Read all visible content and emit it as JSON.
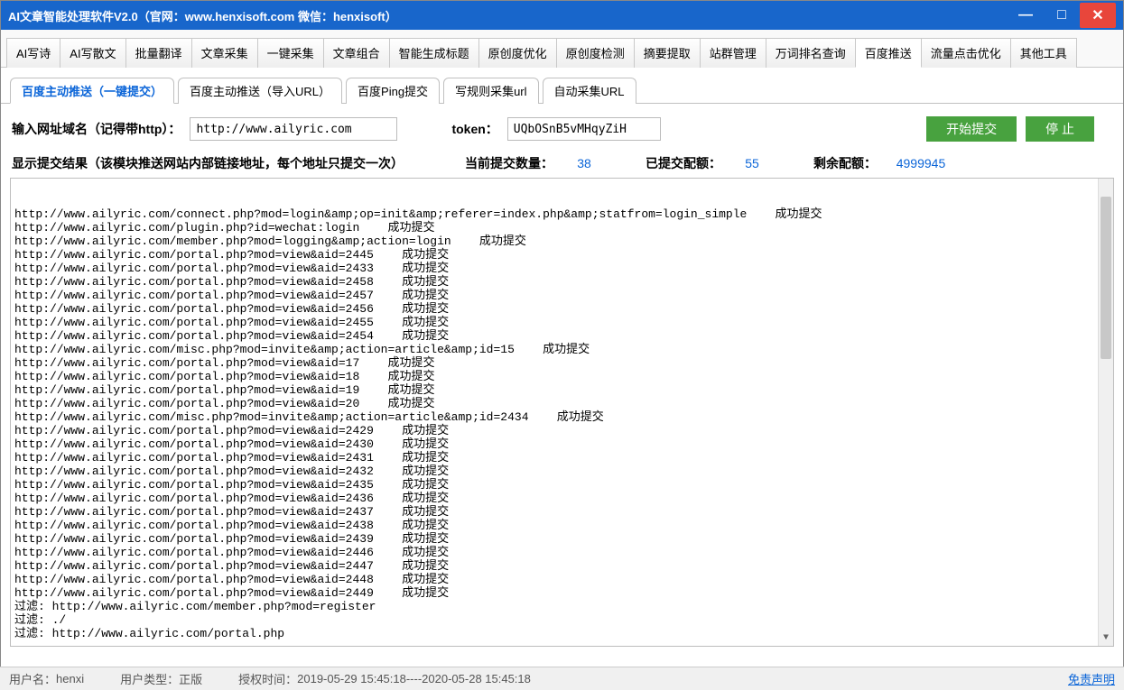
{
  "title": "AI文章智能处理软件V2.0（官网：www.henxisoft.com  微信：henxisoft）",
  "mainTabs": [
    "AI写诗",
    "AI写散文",
    "批量翻译",
    "文章采集",
    "一键采集",
    "文章组合",
    "智能生成标题",
    "原创度优化",
    "原创度检测",
    "摘要提取",
    "站群管理",
    "万词排名查询",
    "百度推送",
    "流量点击优化",
    "其他工具"
  ],
  "mainActive": 12,
  "subTabs": [
    "百度主动推送（一键提交）",
    "百度主动推送（导入URL）",
    "百度Ping提交",
    "写规则采集url",
    "自动采集URL"
  ],
  "subActive": 0,
  "form": {
    "domainLabel": "输入网址域名（记得带http）：",
    "domainValue": "http://www.ailyric.com",
    "tokenLabel": "token：",
    "tokenValue": "UQbOSnB5vMHqyZiH",
    "startBtn": "开始提交",
    "stopBtn": "停  止"
  },
  "stats": {
    "resultLabel": "显示提交结果（该模块推送网站内部链接地址，每个地址只提交一次）",
    "curLabel": "当前提交数量：",
    "cur": "38",
    "doneLabel": "已提交配额：",
    "done": "55",
    "remainLabel": "剩余配额：",
    "remain": "4999945"
  },
  "log": [
    "http://www.ailyric.com/connect.php?mod=login&amp;op=init&amp;referer=index.php&amp;statfrom=login_simple    成功提交",
    "http://www.ailyric.com/plugin.php?id=wechat:login    成功提交",
    "http://www.ailyric.com/member.php?mod=logging&amp;action=login    成功提交",
    "http://www.ailyric.com/portal.php?mod=view&aid=2445    成功提交",
    "http://www.ailyric.com/portal.php?mod=view&aid=2433    成功提交",
    "http://www.ailyric.com/portal.php?mod=view&aid=2458    成功提交",
    "http://www.ailyric.com/portal.php?mod=view&aid=2457    成功提交",
    "http://www.ailyric.com/portal.php?mod=view&aid=2456    成功提交",
    "http://www.ailyric.com/portal.php?mod=view&aid=2455    成功提交",
    "http://www.ailyric.com/portal.php?mod=view&aid=2454    成功提交",
    "http://www.ailyric.com/misc.php?mod=invite&amp;action=article&amp;id=15    成功提交",
    "http://www.ailyric.com/portal.php?mod=view&aid=17    成功提交",
    "http://www.ailyric.com/portal.php?mod=view&aid=18    成功提交",
    "http://www.ailyric.com/portal.php?mod=view&aid=19    成功提交",
    "http://www.ailyric.com/portal.php?mod=view&aid=20    成功提交",
    "http://www.ailyric.com/misc.php?mod=invite&amp;action=article&amp;id=2434    成功提交",
    "http://www.ailyric.com/portal.php?mod=view&aid=2429    成功提交",
    "http://www.ailyric.com/portal.php?mod=view&aid=2430    成功提交",
    "http://www.ailyric.com/portal.php?mod=view&aid=2431    成功提交",
    "http://www.ailyric.com/portal.php?mod=view&aid=2432    成功提交",
    "http://www.ailyric.com/portal.php?mod=view&aid=2435    成功提交",
    "http://www.ailyric.com/portal.php?mod=view&aid=2436    成功提交",
    "http://www.ailyric.com/portal.php?mod=view&aid=2437    成功提交",
    "http://www.ailyric.com/portal.php?mod=view&aid=2438    成功提交",
    "http://www.ailyric.com/portal.php?mod=view&aid=2439    成功提交",
    "http://www.ailyric.com/portal.php?mod=view&aid=2446    成功提交",
    "http://www.ailyric.com/portal.php?mod=view&aid=2447    成功提交",
    "http://www.ailyric.com/portal.php?mod=view&aid=2448    成功提交",
    "http://www.ailyric.com/portal.php?mod=view&aid=2449    成功提交",
    "",
    "过滤: http://www.ailyric.com/member.php?mod=register",
    "过滤: ./",
    "过滤: http://www.ailyric.com/portal.php"
  ],
  "footer": {
    "userLabel": "用户名：",
    "user": "henxi",
    "typeLabel": "用户类型：",
    "type": "正版",
    "authLabel": "授权时间：",
    "auth": "2019-05-29 15:45:18----2020-05-28 15:45:18",
    "link": "免责声明"
  }
}
